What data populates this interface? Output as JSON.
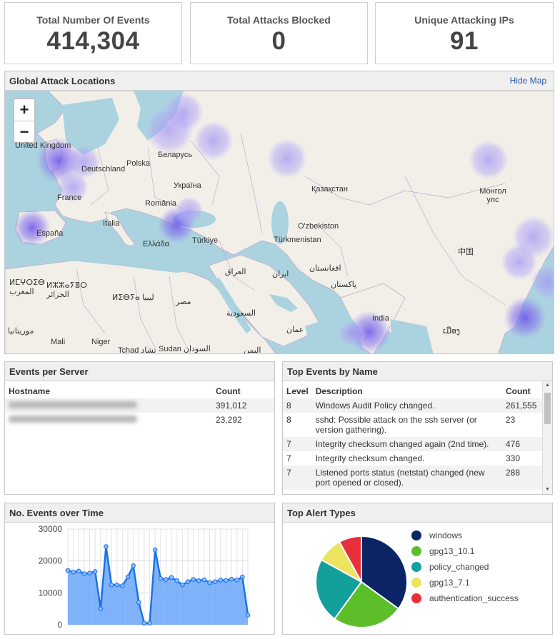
{
  "stats": [
    {
      "label": "Total Number Of Events",
      "value": "414,304"
    },
    {
      "label": "Total Attacks Blocked",
      "value": "0"
    },
    {
      "label": "Unique Attacking IPs",
      "value": "91"
    }
  ],
  "map_panel": {
    "title": "Global Attack Locations",
    "hide_link": "Hide Map",
    "zoom_in": "+",
    "zoom_out": "−",
    "labels": [
      "United Kingdom",
      "Deutschland",
      "Polska",
      "Беларусь",
      "France",
      "Україна",
      "România",
      "España",
      "Italia",
      "Ελλάδα",
      "Türkiye",
      "Қазақстан",
      "Монгол улс",
      "O'zbekiston",
      "Türkmenistan",
      "中国",
      "العراق",
      "ایران",
      "افغانستان",
      "پاکستان",
      "India",
      "ⵍⵎⵖⵔⵉⴱ المغرب",
      "ⵍⵣⵣⴰⵢⴻⵔ الجزائر",
      "ⵍⵉⴱⵢⴰ ليبيا",
      "مصر",
      "السعودية",
      "عمان",
      "موريتانيا",
      "Mali",
      "Niger",
      "Tchad تشاد",
      "Sudan السودان",
      "اليمن",
      "ເມືອງ"
    ]
  },
  "events_per_server": {
    "title": "Events per Server",
    "columns": [
      "Hostname",
      "Count"
    ],
    "rows": [
      {
        "count": "391,012"
      },
      {
        "count": "23,292"
      }
    ]
  },
  "top_events": {
    "title": "Top Events by Name",
    "columns": [
      "Level",
      "Description",
      "Count"
    ],
    "rows": [
      {
        "level": "8",
        "description": "Windows Audit Policy changed.",
        "count": "261,555"
      },
      {
        "level": "8",
        "description": "sshd: Possible attack on the ssh server (or version gathering).",
        "count": "23"
      },
      {
        "level": "7",
        "description": "Integrity checksum changed again (2nd time).",
        "count": "476"
      },
      {
        "level": "7",
        "description": "Integrity checksum changed.",
        "count": "330"
      },
      {
        "level": "7",
        "description": "Listened ports status (netstat) changed (new port opened or closed).",
        "count": "288"
      }
    ]
  },
  "events_over_time": {
    "title": "No. Events over Time",
    "chart_data": {
      "type": "area",
      "ylim": [
        0,
        30000
      ],
      "y_ticks": [
        "30000",
        "20000",
        "10000",
        "0"
      ],
      "values": [
        17000,
        16500,
        16800,
        16000,
        16200,
        16700,
        5000,
        24500,
        12500,
        12500,
        12200,
        15000,
        18500,
        7000,
        500,
        500,
        23500,
        14500,
        14200,
        14800,
        13800,
        12500,
        13500,
        14200,
        13800,
        14100,
        13200,
        13500,
        14000,
        13900,
        14300,
        14000,
        15000,
        3000
      ],
      "color": "#6aa6f8"
    }
  },
  "top_alert_types": {
    "title": "Top Alert Types",
    "chart_data": {
      "type": "pie",
      "labels": [
        "windows",
        "gpg13_10.1",
        "policy_changed",
        "gpg13_7.1",
        "authentication_success"
      ],
      "values": [
        35,
        25,
        23,
        9,
        8
      ],
      "colors": [
        "#0a2465",
        "#5cbf2a",
        "#13a09c",
        "#ece35f",
        "#e8303c"
      ]
    }
  }
}
